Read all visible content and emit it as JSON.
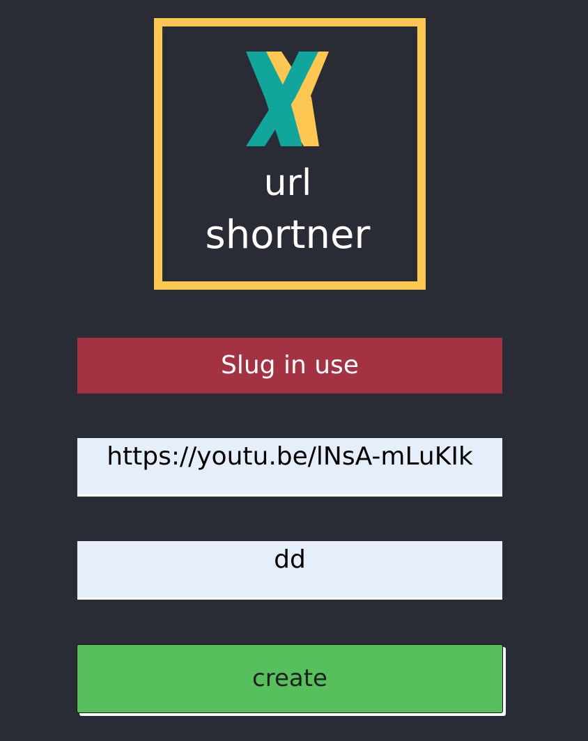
{
  "logo": {
    "mark": "X",
    "line1": "url",
    "line2": "shortner",
    "colors": {
      "frame": "#fec752",
      "teal": "#12a59b",
      "yellow": "#fec752",
      "text": "#ffffff"
    }
  },
  "error": {
    "message": "Slug in use",
    "color": "#a33343"
  },
  "form": {
    "url_value": "https://youtu.be/lNsA-mLuKIk",
    "slug_value": "dd",
    "create_label": "create",
    "button_color": "#57bf5c"
  }
}
